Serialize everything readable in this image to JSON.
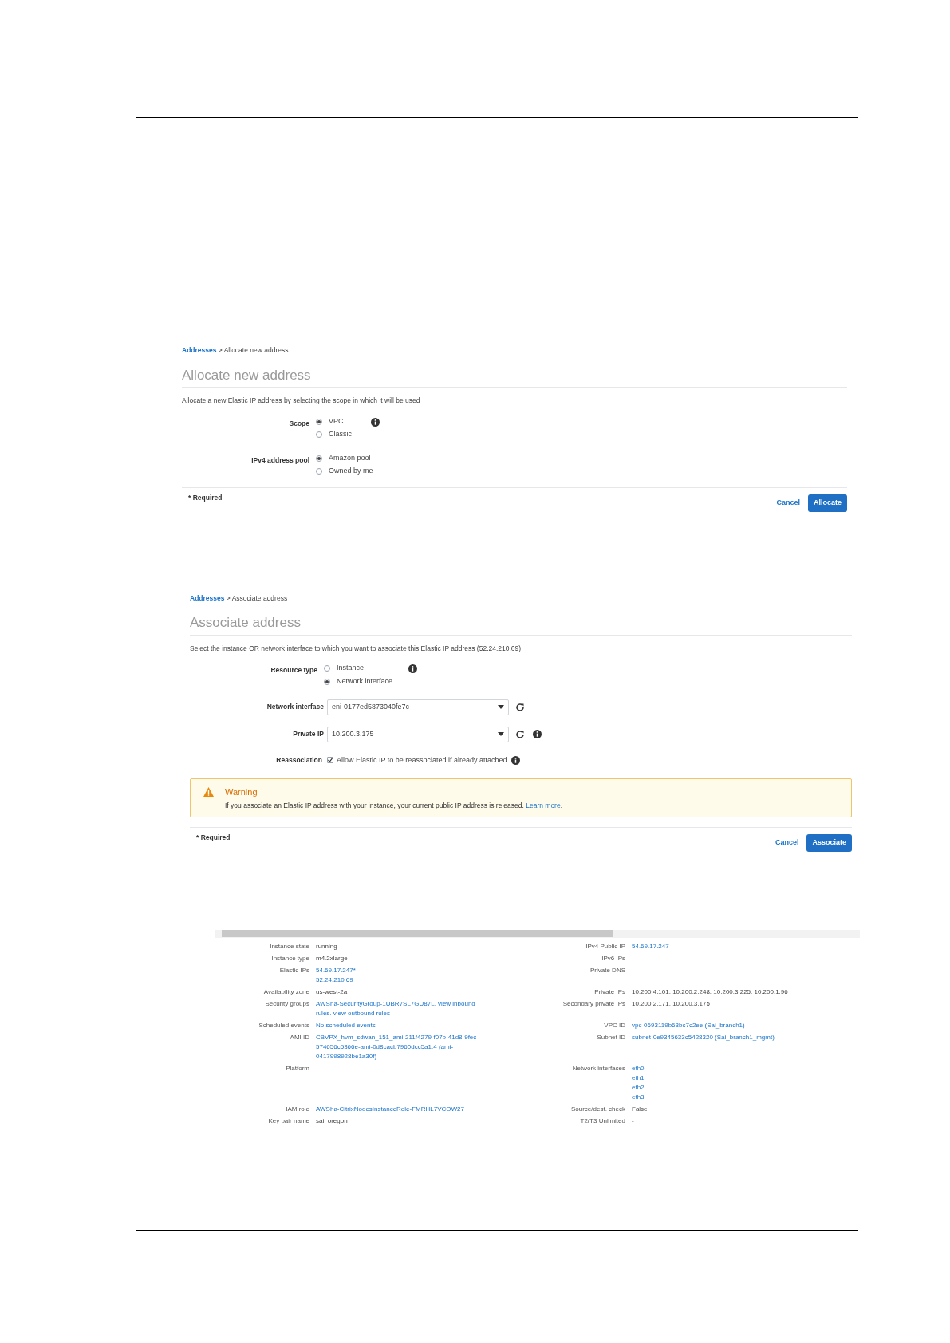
{
  "allocate": {
    "breadcrumb_link": "Addresses",
    "breadcrumb_rest": "> Allocate new address",
    "title": "Allocate new address",
    "description": "Allocate a new Elastic IP address by selecting the scope in which it will be used",
    "groups": [
      {
        "label": "Scope",
        "info": true,
        "options": [
          {
            "label": "VPC",
            "selected": true
          },
          {
            "label": "Classic",
            "selected": false
          }
        ]
      },
      {
        "label": "IPv4 address pool",
        "info": false,
        "options": [
          {
            "label": "Amazon pool",
            "selected": true
          },
          {
            "label": "Owned by me",
            "selected": false
          }
        ]
      }
    ],
    "required": "* Required",
    "cancel": "Cancel",
    "submit": "Allocate"
  },
  "associate": {
    "breadcrumb_link": "Addresses",
    "breadcrumb_rest": "> Associate address",
    "title": "Associate address",
    "description": "Select the instance OR network interface to which you want to associate this Elastic IP address (52.24.210.69)",
    "resource_type": {
      "label": "Resource type",
      "options": [
        {
          "label": "Instance",
          "selected": false
        },
        {
          "label": "Network interface",
          "selected": true
        }
      ]
    },
    "network_interface": {
      "label": "Network interface",
      "value": "eni-0177ed5873040fe7c"
    },
    "private_ip": {
      "label": "Private IP",
      "value": "10.200.3.175"
    },
    "reassociation": {
      "label": "Reassociation",
      "text": "Allow Elastic IP to be reassociated if already attached",
      "checked": true
    },
    "warning": {
      "title": "Warning",
      "text": "If you associate an Elastic IP address with your instance, your current public IP address is released.",
      "link": "Learn more",
      "end": "."
    },
    "required": "* Required",
    "cancel": "Cancel",
    "submit": "Associate"
  },
  "details": {
    "rows": [
      {
        "left": {
          "label": "Instance state",
          "lines": [
            "running"
          ],
          "link": false
        },
        "right": {
          "label": "IPv4 Public IP",
          "lines": [
            "54.69.17.247"
          ],
          "link": true
        }
      },
      {
        "left": {
          "label": "Instance type",
          "lines": [
            "m4.2xlarge"
          ],
          "link": false
        },
        "right": {
          "label": "IPv6 IPs",
          "lines": [
            "-"
          ],
          "link": false
        }
      },
      {
        "left": {
          "label": "Elastic IPs",
          "lines": [
            "54.69.17.247*",
            "52.24.210.69"
          ],
          "link": true
        },
        "right": {
          "label": "Private DNS",
          "lines": [
            "-"
          ],
          "link": false
        }
      },
      {
        "left": {
          "label": "Availability zone",
          "lines": [
            "us-west-2a"
          ],
          "link": false
        },
        "right": {
          "label": "Private IPs",
          "lines": [
            "10.200.4.101, 10.200.2.248, 10.200.3.225, 10.200.1.96"
          ],
          "link": false
        }
      },
      {
        "left": {
          "label": "Security groups",
          "lines": [
            "AWSha-SecurityGroup-1UBR7SL7GU87L. view inbound",
            "rules. view outbound rules"
          ],
          "link": true
        },
        "right": {
          "label": "Secondary private IPs",
          "lines": [
            "10.200.2.171, 10.200.3.175"
          ],
          "link": false
        }
      },
      {
        "left": {
          "label": "Scheduled events",
          "lines": [
            "No scheduled events"
          ],
          "link": true
        },
        "right": {
          "label": "VPC ID",
          "lines": [
            "vpc-0693119b63bc7c2ee (Sai_branch1)"
          ],
          "link": true
        }
      },
      {
        "left": {
          "label": "AMI ID",
          "lines": [
            "CBVPX_hvm_sdwan_151_ami-211f4279-f07b-41d8-9fec-",
            "574656c5366e-ami-0d8cacb7960dcc5a1.4 (ami-",
            "0417998928be1a30f)"
          ],
          "link": true
        },
        "right": {
          "label": "Subnet ID",
          "lines": [
            "subnet-0e9345633c5428320 (Sai_branch1_mgmt)"
          ],
          "link": true
        }
      },
      {
        "left": {
          "label": "Platform",
          "lines": [
            "-"
          ],
          "link": false
        },
        "right": {
          "label": "Network interfaces",
          "lines": [
            "eth0",
            "eth1",
            "eth2",
            "eth3"
          ],
          "link": true
        }
      },
      {
        "left": {
          "label": "IAM role",
          "lines": [
            "AWSha-CitrixNodesInstanceRole-FMRHL7VCOW27"
          ],
          "link": true
        },
        "right": {
          "label": "Source/dest. check",
          "lines": [
            "False"
          ],
          "link": false
        }
      },
      {
        "left": {
          "label": "Key pair name",
          "lines": [
            "sai_oregon"
          ],
          "link": false
        },
        "right": {
          "label": "T2/T3 Unlimited",
          "lines": [
            "-"
          ],
          "link": false
        }
      }
    ]
  }
}
